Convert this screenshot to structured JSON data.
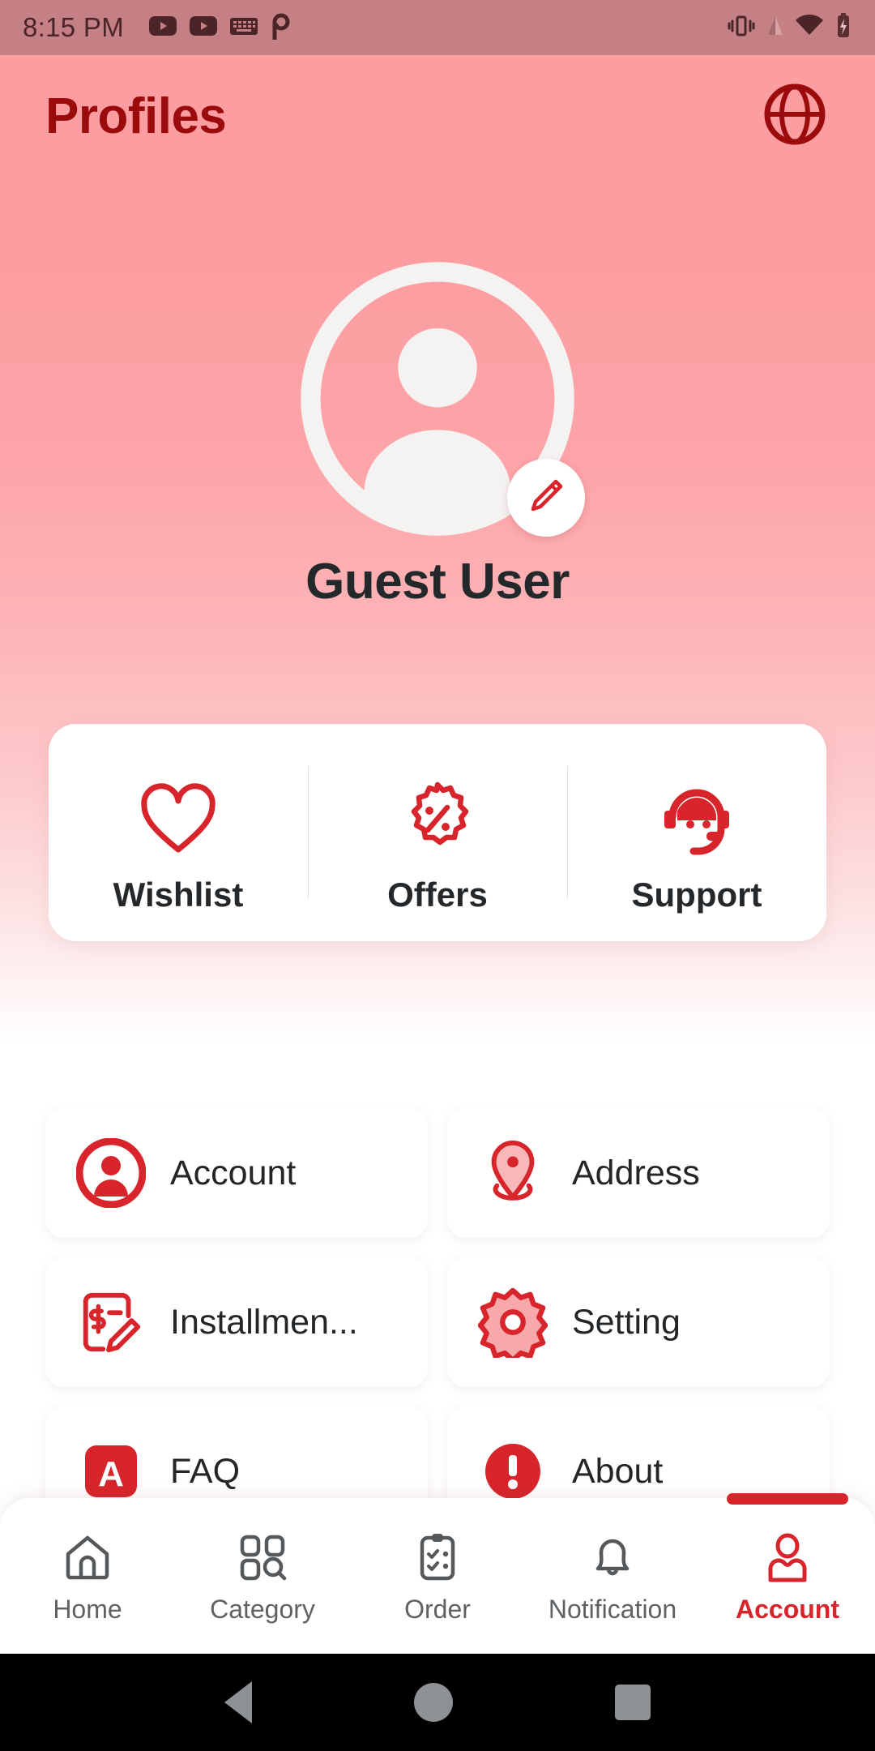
{
  "status_bar": {
    "time": "8:15 PM",
    "left_icons": [
      "youtube-icon",
      "youtube-music-icon",
      "keyboard-icon",
      "pinterest-icon"
    ],
    "right_icons": [
      "vibrate-icon",
      "signal-icon",
      "wifi-icon",
      "battery-charging-icon"
    ]
  },
  "app_bar": {
    "title": "Profiles",
    "language_icon": "globe-icon"
  },
  "profile": {
    "avatar_icon": "person-avatar-icon",
    "edit_icon": "pencil-icon",
    "name": "Guest User"
  },
  "quick_actions": [
    {
      "label": "Wishlist",
      "icon": "heart-icon"
    },
    {
      "label": "Offers",
      "icon": "discount-badge-icon"
    },
    {
      "label": "Support",
      "icon": "headset-support-icon"
    }
  ],
  "menu_items": [
    {
      "label": "Account",
      "icon": "person-circle-icon"
    },
    {
      "label": "Address",
      "icon": "map-pin-icon"
    },
    {
      "label": "Installmen...",
      "icon": "installment-invoice-icon"
    },
    {
      "label": "Setting",
      "icon": "gear-icon"
    },
    {
      "label": "FAQ",
      "icon": "faq-badge-icon"
    },
    {
      "label": "About",
      "icon": "info-circle-icon"
    }
  ],
  "bottom_nav": {
    "active_index": 4,
    "items": [
      {
        "label": "Home",
        "icon": "home-icon"
      },
      {
        "label": "Category",
        "icon": "category-grid-search-icon"
      },
      {
        "label": "Order",
        "icon": "clipboard-checklist-icon"
      },
      {
        "label": "Notification",
        "icon": "bell-icon"
      },
      {
        "label": "Account",
        "icon": "person-outline-icon"
      }
    ]
  },
  "system_nav": {
    "back": "back-triangle-icon",
    "home": "home-circle-icon",
    "recents": "recents-square-icon"
  },
  "colors": {
    "accent_red": "#D8252B",
    "title_dark_red": "#9C0B0C",
    "bg_pink_top": "#FC9DA1",
    "bg_white": "#FFFFFF",
    "status_bar": "#C48084",
    "text_dark": "#23282B"
  }
}
